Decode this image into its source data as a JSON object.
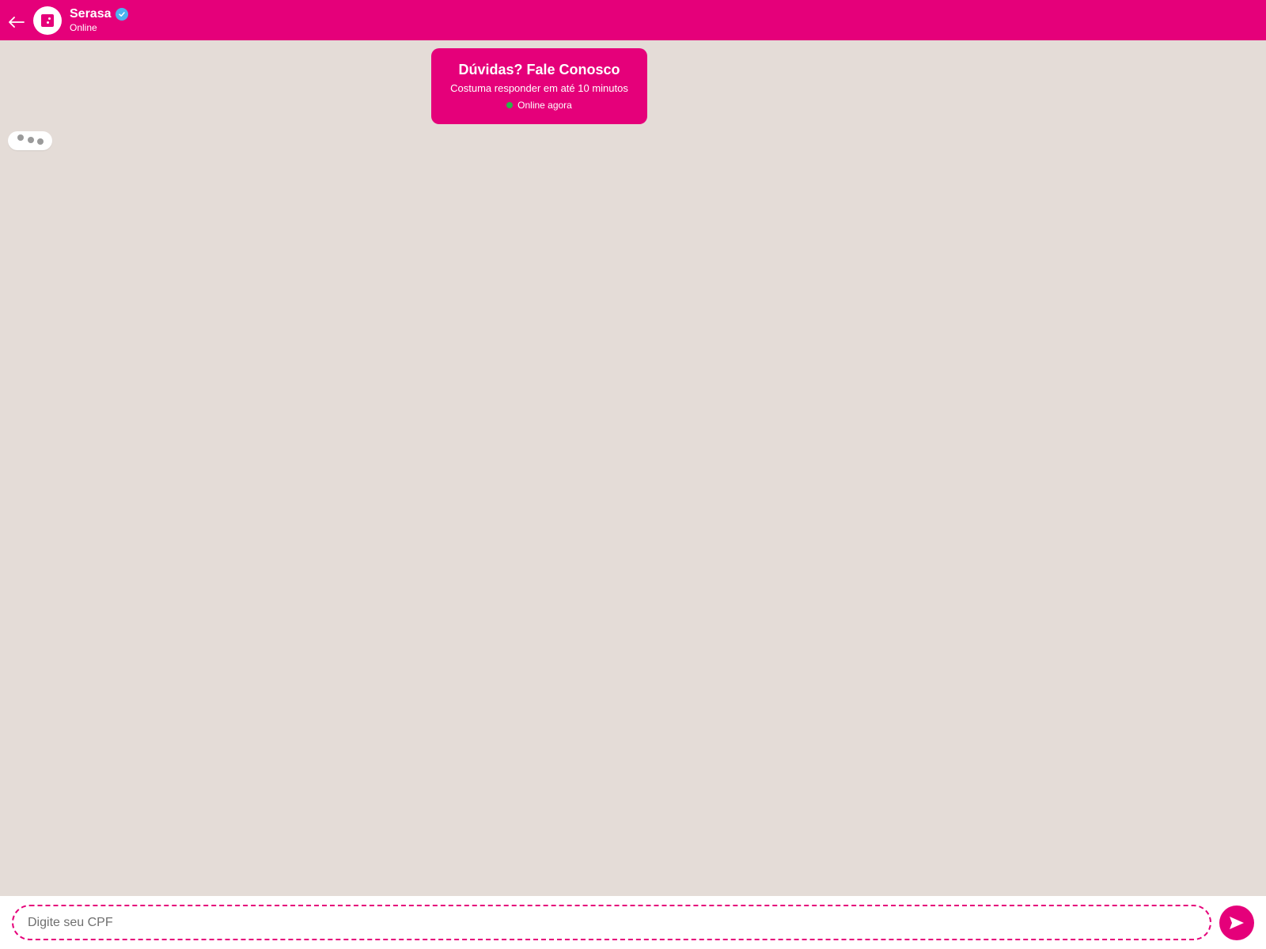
{
  "header": {
    "name": "Serasa",
    "status": "Online",
    "back_icon": "arrow-left-icon",
    "verified_icon": "verified-check-icon"
  },
  "info_card": {
    "title": "Dúvidas? Fale Conosco",
    "subtitle": "Costuma responder em até 10 minutos",
    "online_label": "Online agora"
  },
  "input": {
    "placeholder": "Digite seu CPF",
    "value": ""
  },
  "send_button": {
    "icon": "send-icon"
  },
  "colors": {
    "brand": "#e5007a",
    "chat_background": "#e4dcd7",
    "online_dot": "#2bb34a",
    "verified": "#4cb4ee"
  }
}
